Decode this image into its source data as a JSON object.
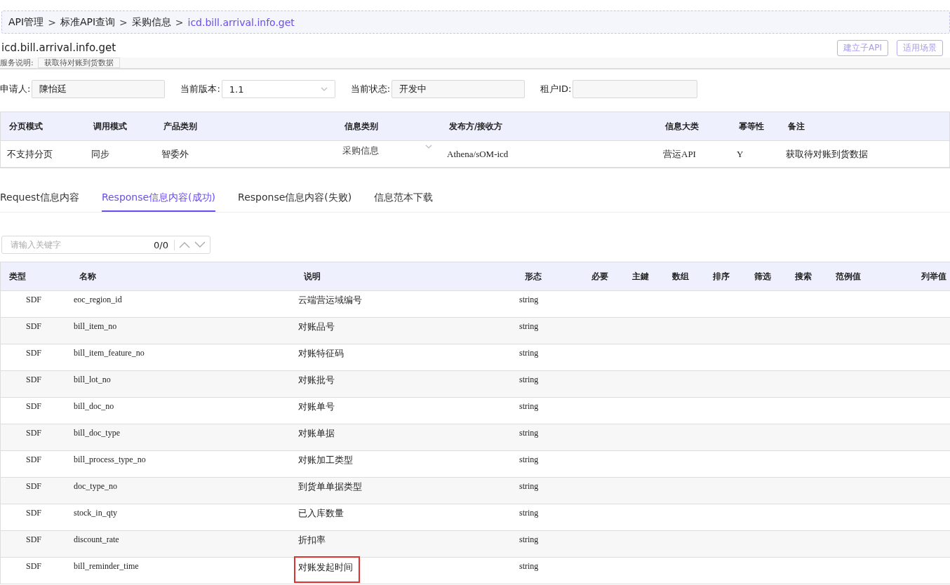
{
  "breadcrumb": [
    {
      "label": "API管理",
      "current": false
    },
    {
      "label": "标准API查询",
      "current": false
    },
    {
      "label": "采购信息",
      "current": false
    },
    {
      "label": "icd.bill.arrival.info.get",
      "current": true
    }
  ],
  "breadcrumb_separator": ">",
  "title": "icd.bill.arrival.info.get",
  "header_buttons": [
    "建立子API",
    "适用场景"
  ],
  "service_desc": {
    "label": "服务说明:",
    "value": "获取待对账到货数据"
  },
  "fields": [
    {
      "label": "申请人:",
      "value": "陳怡廷",
      "kind": "text"
    },
    {
      "label": "当前版本:",
      "value": "1.1",
      "kind": "select"
    },
    {
      "label": "当前状态:",
      "value": "开发中",
      "kind": "text"
    },
    {
      "label": "租户ID:",
      "kind": "text"
    }
  ],
  "info_table": {
    "columns": [
      "分页模式",
      "调用模式",
      "产品类别",
      "信息类别",
      "发布方/接收方",
      "信息大类",
      "幂等性",
      "备注"
    ],
    "row": [
      {
        "value": "不支持分页",
        "kind": "text"
      },
      {
        "value": "同步",
        "kind": "text"
      },
      {
        "value": "智委外",
        "kind": "text"
      },
      {
        "value": "采购信息",
        "kind": "select"
      },
      {
        "value": "Athena/sOM-icd",
        "kind": "text"
      },
      {
        "value": "营运API",
        "kind": "text"
      },
      {
        "value": "Y",
        "kind": "text"
      },
      {
        "value": "获取待对账到货数据",
        "kind": "text"
      }
    ]
  },
  "tabs": [
    {
      "label": "Request信息内容",
      "selected": false
    },
    {
      "label": "Response信息内容(成功)",
      "selected": true
    },
    {
      "label": "Response信息内容(失败)",
      "selected": false
    },
    {
      "label": "信息范本下载",
      "selected": false
    }
  ],
  "search": {
    "placeholder": "请输入关键字",
    "count": "0/0"
  },
  "table": {
    "columns": [
      "类型",
      "名称",
      "说明",
      "形态",
      "必要",
      "主鍵",
      "数组",
      "排序",
      "筛选",
      "搜索",
      "范例值",
      "列举值"
    ],
    "rows": [
      {
        "type": "SDF",
        "name": "eoc_region_id",
        "desc": "云端营运域编号",
        "form": "string",
        "highlighted": false
      },
      {
        "type": "SDF",
        "name": "bill_item_no",
        "desc": "对账品号",
        "form": "string",
        "highlighted": false
      },
      {
        "type": "SDF",
        "name": "bill_item_feature_no",
        "desc": "对账特征码",
        "form": "string",
        "highlighted": false
      },
      {
        "type": "SDF",
        "name": "bill_lot_no",
        "desc": "对账批号",
        "form": "string",
        "highlighted": false
      },
      {
        "type": "SDF",
        "name": "bill_doc_no",
        "desc": "对账单号",
        "form": "string",
        "highlighted": false
      },
      {
        "type": "SDF",
        "name": "bill_doc_type",
        "desc": "对账单据",
        "form": "string",
        "highlighted": false
      },
      {
        "type": "SDF",
        "name": "bill_process_type_no",
        "desc": "对账加工类型",
        "form": "string",
        "highlighted": false
      },
      {
        "type": "SDF",
        "name": "doc_type_no",
        "desc": "到货单单据类型",
        "form": "string",
        "highlighted": false
      },
      {
        "type": "SDF",
        "name": "stock_in_qty",
        "desc": "已入库数量",
        "form": "string",
        "highlighted": false
      },
      {
        "type": "SDF",
        "name": "discount_rate",
        "desc": "折扣率",
        "form": "string",
        "highlighted": false
      },
      {
        "type": "SDF",
        "name": "bill_reminder_time",
        "desc": "对账发起时间",
        "form": "string",
        "highlighted": true
      }
    ]
  }
}
